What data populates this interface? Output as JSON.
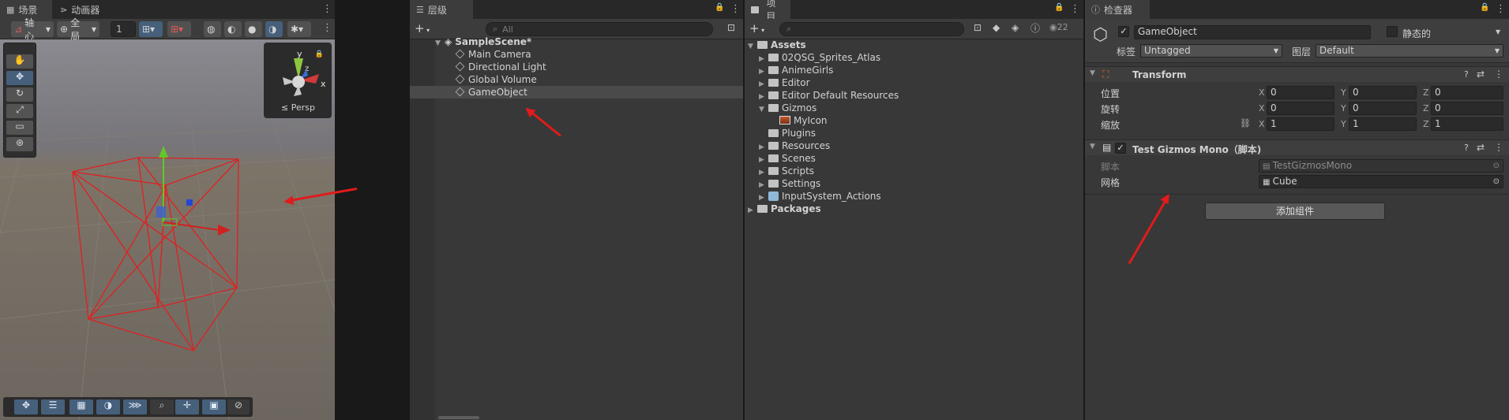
{
  "scene_panel": {
    "tabs": [
      {
        "label": "场景"
      },
      {
        "label": "动画器"
      }
    ],
    "toolbar": {
      "pivot": "轴心",
      "space": "全局",
      "grid_value": "1"
    },
    "gizmo": {
      "persp_label": "≤ Persp",
      "axis_y": "y",
      "axis_x": "x",
      "axis_z": "z"
    }
  },
  "hierarchy": {
    "tab": "层级",
    "search_placeholder": "All",
    "scene_name": "SampleScene*",
    "items": [
      {
        "label": "Main Camera"
      },
      {
        "label": "Directional Light"
      },
      {
        "label": "Global Volume"
      },
      {
        "label": "GameObject"
      }
    ]
  },
  "project": {
    "tab": "项目",
    "hidden_count": "22",
    "tree": [
      {
        "label": "Assets"
      },
      {
        "label": "02QSG_Sprites_Atlas"
      },
      {
        "label": "AnimeGirls"
      },
      {
        "label": "Editor"
      },
      {
        "label": "Editor Default Resources"
      },
      {
        "label": "Gizmos"
      },
      {
        "label": "MyIcon"
      },
      {
        "label": "Plugins"
      },
      {
        "label": "Resources"
      },
      {
        "label": "Scenes"
      },
      {
        "label": "Scripts"
      },
      {
        "label": "Settings"
      },
      {
        "label": "InputSystem_Actions"
      },
      {
        "label": "Packages"
      }
    ]
  },
  "inspector": {
    "tab": "检查器",
    "object_name": "GameObject",
    "static_label": "静态的",
    "tag_label": "标签",
    "tag_value": "Untagged",
    "layer_label": "图层",
    "layer_value": "Default",
    "transform": {
      "title": "Transform",
      "position_label": "位置",
      "rotation_label": "旋转",
      "scale_label": "缩放",
      "position": {
        "x": "0",
        "y": "0",
        "z": "0"
      },
      "rotation": {
        "x": "0",
        "y": "0",
        "z": "0"
      },
      "scale": {
        "x": "1",
        "y": "1",
        "z": "1"
      }
    },
    "component": {
      "title": "Test Gizmos Mono（脚本)",
      "script_label": "脚本",
      "script_value": "TestGizmosMono",
      "mesh_label": "网格",
      "mesh_value": "Cube"
    },
    "add_component": "添加组件",
    "axis_labels": {
      "x": "X",
      "y": "Y",
      "z": "Z"
    }
  },
  "colors": {
    "annotation_arrow": "#e01b1b",
    "selection": "#46607c",
    "wireframe": "#e02020"
  }
}
